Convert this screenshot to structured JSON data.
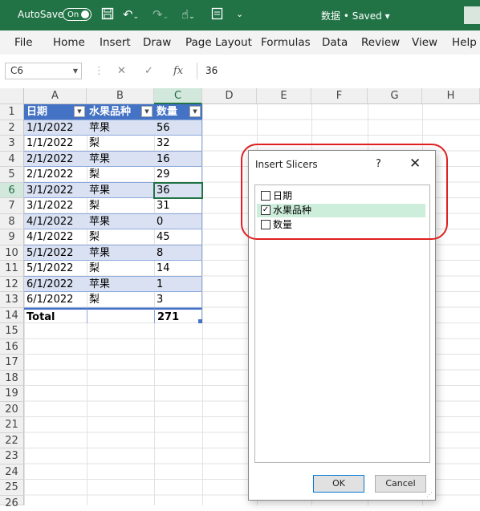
{
  "titlebar": {
    "autosave_label": "AutoSave",
    "autosave_state": "On",
    "doc_title": "数据 • Saved ▾",
    "icons": [
      "save-icon",
      "undo-icon",
      "redo-icon",
      "touch-mode-icon",
      "form-icon",
      "customize-qat-icon"
    ]
  },
  "menu": [
    "File",
    "Home",
    "Insert",
    "Draw",
    "Page Layout",
    "Formulas",
    "Data",
    "Review",
    "View",
    "Help"
  ],
  "formula_bar": {
    "name_box": "C6",
    "fx": "fx",
    "cancel": "✕",
    "enter": "✓",
    "value": "36"
  },
  "columns": [
    "A",
    "B",
    "C",
    "D",
    "E",
    "F",
    "G",
    "H"
  ],
  "rows": [
    "1",
    "2",
    "3",
    "4",
    "5",
    "6",
    "7",
    "8",
    "9",
    "10",
    "11",
    "12",
    "13",
    "14",
    "15",
    "16",
    "17",
    "18",
    "19",
    "20",
    "21",
    "22",
    "23",
    "24",
    "25",
    "26"
  ],
  "table": {
    "headers": [
      "日期",
      "水果品种",
      "数量"
    ],
    "data": [
      [
        "1/1/2022",
        "苹果",
        "56"
      ],
      [
        "1/1/2022",
        "梨",
        "32"
      ],
      [
        "2/1/2022",
        "苹果",
        "16"
      ],
      [
        "2/1/2022",
        "梨",
        "29"
      ],
      [
        "3/1/2022",
        "苹果",
        "36"
      ],
      [
        "3/1/2022",
        "梨",
        "31"
      ],
      [
        "4/1/2022",
        "苹果",
        "0"
      ],
      [
        "4/1/2022",
        "梨",
        "45"
      ],
      [
        "5/1/2022",
        "苹果",
        "8"
      ],
      [
        "5/1/2022",
        "梨",
        "14"
      ],
      [
        "6/1/2022",
        "苹果",
        "1"
      ],
      [
        "6/1/2022",
        "梨",
        "3"
      ]
    ],
    "total_label": "Total",
    "total_value": "271"
  },
  "dialog": {
    "title": "Insert Slicers",
    "help": "?",
    "close": "✕",
    "fields": [
      {
        "label": "日期",
        "checked": false
      },
      {
        "label": "水果品种",
        "checked": true
      },
      {
        "label": "数量",
        "checked": false
      }
    ],
    "ok_label": "OK",
    "cancel_label": "Cancel"
  },
  "colors": {
    "excel_green": "#217346",
    "table_header": "#4472c4",
    "table_band": "#d9e1f2",
    "annotation": "#e02020"
  }
}
